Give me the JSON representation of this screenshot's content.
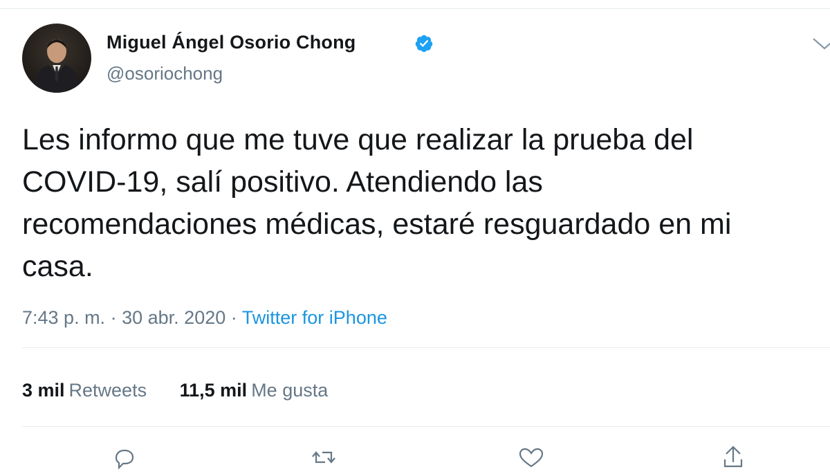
{
  "tweet": {
    "author": {
      "name": "Miguel Ángel Osorio Chong",
      "handle": "@osoriochong"
    },
    "text": "Les informo que me tuve que realizar la prueba del\nCOVID-19, salí positivo. Atendiendo las\nrecomendaciones médicas, estaré resguardado en mi\ncasa.",
    "time": "7:43 p. m.",
    "separator": "·",
    "date": "30 abr. 2020",
    "source": "Twitter for iPhone",
    "stats": {
      "retweets_count": "3 mil",
      "retweets_label": "Retweets",
      "likes_count": "11,5 mil",
      "likes_label": "Me gusta"
    }
  },
  "icons": {
    "verified": "verified-badge-icon",
    "menu": "chevron-down-icon",
    "reply": "reply-icon",
    "retweet": "retweet-icon",
    "like": "heart-icon",
    "share": "share-icon"
  },
  "colors": {
    "text": "#14171a",
    "secondary": "#657786",
    "link": "#1b95e0",
    "verified": "#1da1f2",
    "divider": "#e6ecf0"
  }
}
